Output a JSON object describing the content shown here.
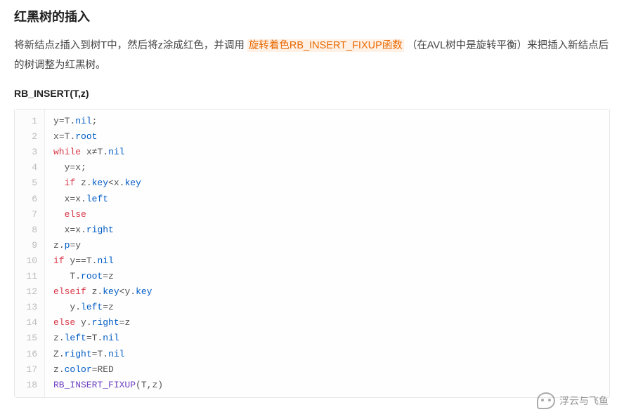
{
  "heading": "红黑树的插入",
  "paragraph": {
    "pre": "将新结点z插入到树T中，然后将z涂成红色，并调用 ",
    "link": "旋转着色RB_INSERT_FIXUP函数",
    "post": " （在AVL树中是旋转平衡）来把插入新结点后的树调整为红黑树。"
  },
  "subheading": "RB_INSERT(T,z)",
  "code": [
    {
      "n": 1,
      "tokens": [
        [
          "",
          "y"
        ],
        [
          "op",
          "="
        ],
        [
          "",
          "T"
        ],
        [
          "op",
          "."
        ],
        [
          "prop",
          "nil"
        ],
        [
          "op",
          ";"
        ]
      ]
    },
    {
      "n": 2,
      "tokens": [
        [
          "",
          "x"
        ],
        [
          "op",
          "="
        ],
        [
          "",
          "T"
        ],
        [
          "op",
          "."
        ],
        [
          "prop",
          "root"
        ]
      ]
    },
    {
      "n": 3,
      "tokens": [
        [
          "kw",
          "while"
        ],
        [
          "",
          " x"
        ],
        [
          "op",
          "≠"
        ],
        [
          "",
          "T"
        ],
        [
          "op",
          "."
        ],
        [
          "prop",
          "nil"
        ]
      ]
    },
    {
      "n": 4,
      "indent": 1,
      "tokens": [
        [
          "",
          "y"
        ],
        [
          "op",
          "="
        ],
        [
          "",
          "x;"
        ]
      ]
    },
    {
      "n": 5,
      "indent": 1,
      "tokens": [
        [
          "kw",
          "if"
        ],
        [
          "",
          " z"
        ],
        [
          "op",
          "."
        ],
        [
          "prop",
          "key"
        ],
        [
          "op",
          "<"
        ],
        [
          "",
          "x"
        ],
        [
          "op",
          "."
        ],
        [
          "prop",
          "key"
        ]
      ]
    },
    {
      "n": 6,
      "indent": 1,
      "tokens": [
        [
          "",
          "x"
        ],
        [
          "op",
          "="
        ],
        [
          "",
          "x"
        ],
        [
          "op",
          "."
        ],
        [
          "prop",
          "left"
        ]
      ]
    },
    {
      "n": 7,
      "indent": 1,
      "tokens": [
        [
          "kw",
          "else"
        ]
      ]
    },
    {
      "n": 8,
      "indent": 1,
      "tokens": [
        [
          "",
          "x"
        ],
        [
          "op",
          "="
        ],
        [
          "",
          "x"
        ],
        [
          "op",
          "."
        ],
        [
          "prop",
          "right"
        ]
      ]
    },
    {
      "n": 9,
      "tokens": [
        [
          "",
          "z"
        ],
        [
          "op",
          "."
        ],
        [
          "prop",
          "p"
        ],
        [
          "op",
          "="
        ],
        [
          "",
          "y"
        ]
      ]
    },
    {
      "n": 10,
      "tokens": [
        [
          "kw",
          "if"
        ],
        [
          "",
          " y"
        ],
        [
          "op",
          "=="
        ],
        [
          "",
          "T"
        ],
        [
          "op",
          "."
        ],
        [
          "prop",
          "nil"
        ]
      ]
    },
    {
      "n": 11,
      "indent": 2,
      "tokens": [
        [
          "",
          "T"
        ],
        [
          "op",
          "."
        ],
        [
          "prop",
          "root"
        ],
        [
          "op",
          "="
        ],
        [
          "",
          "z"
        ]
      ]
    },
    {
      "n": 12,
      "tokens": [
        [
          "kw",
          "elseif"
        ],
        [
          "",
          " z"
        ],
        [
          "op",
          "."
        ],
        [
          "prop",
          "key"
        ],
        [
          "op",
          "<"
        ],
        [
          "",
          "y"
        ],
        [
          "op",
          "."
        ],
        [
          "prop",
          "key"
        ]
      ]
    },
    {
      "n": 13,
      "indent": 2,
      "tokens": [
        [
          "",
          "y"
        ],
        [
          "op",
          "."
        ],
        [
          "prop",
          "left"
        ],
        [
          "op",
          "="
        ],
        [
          "",
          "z"
        ]
      ]
    },
    {
      "n": 14,
      "tokens": [
        [
          "kw",
          "else"
        ],
        [
          "",
          " y"
        ],
        [
          "op",
          "."
        ],
        [
          "prop",
          "right"
        ],
        [
          "op",
          "="
        ],
        [
          "",
          "z"
        ]
      ]
    },
    {
      "n": 15,
      "tokens": [
        [
          "",
          "z"
        ],
        [
          "op",
          "."
        ],
        [
          "prop",
          "left"
        ],
        [
          "op",
          "="
        ],
        [
          "",
          "T"
        ],
        [
          "op",
          "."
        ],
        [
          "prop",
          "nil"
        ]
      ]
    },
    {
      "n": 16,
      "tokens": [
        [
          "",
          "Z"
        ],
        [
          "op",
          "."
        ],
        [
          "prop",
          "right"
        ],
        [
          "op",
          "="
        ],
        [
          "",
          "T"
        ],
        [
          "op",
          "."
        ],
        [
          "prop",
          "nil"
        ]
      ]
    },
    {
      "n": 17,
      "tokens": [
        [
          "",
          "z"
        ],
        [
          "op",
          "."
        ],
        [
          "prop",
          "color"
        ],
        [
          "op",
          "="
        ],
        [
          "",
          "RED"
        ]
      ]
    },
    {
      "n": 18,
      "tokens": [
        [
          "fn",
          "RB_INSERT_FIXUP"
        ],
        [
          "op",
          "("
        ],
        [
          "",
          "T"
        ],
        [
          "op",
          ","
        ],
        [
          "",
          "z"
        ],
        [
          "op",
          ")"
        ]
      ]
    }
  ],
  "watermark": "浮云与飞鱼"
}
